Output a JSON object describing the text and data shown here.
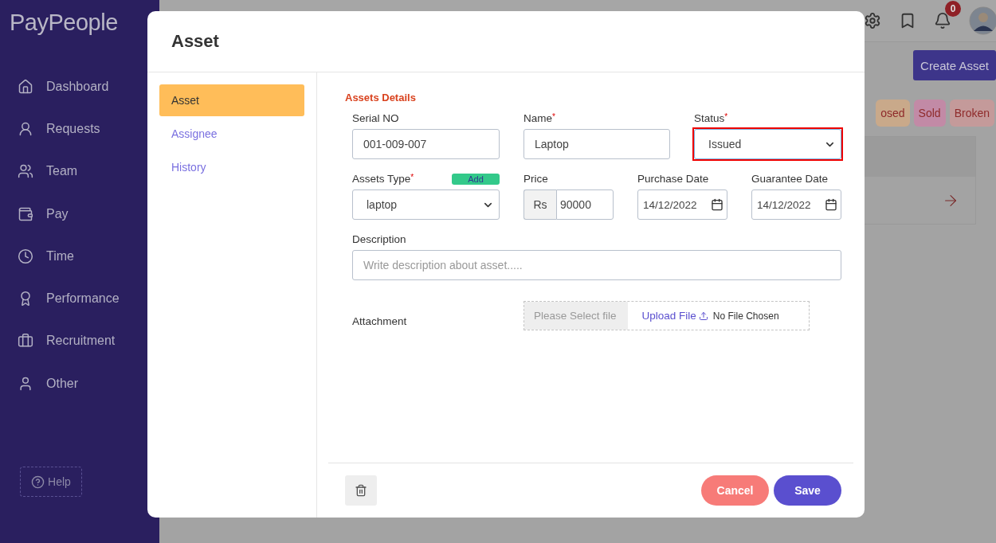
{
  "logo": "PayPeople",
  "sidebar": {
    "items": [
      {
        "label": "Dashboard"
      },
      {
        "label": "Requests"
      },
      {
        "label": "Team"
      },
      {
        "label": "Pay"
      },
      {
        "label": "Time"
      },
      {
        "label": "Performance"
      },
      {
        "label": "Recruitment"
      },
      {
        "label": "Other"
      }
    ],
    "help": "Help"
  },
  "topbar": {
    "notification_count": "0"
  },
  "page": {
    "create_button": "Create Asset",
    "filters": [
      {
        "label": "osed",
        "color": "#c9a98a"
      },
      {
        "label": "Sold",
        "color": "#c28aa6"
      },
      {
        "label": "Broken",
        "color": "#c49a9a"
      }
    ]
  },
  "modal": {
    "title": "Asset",
    "tabs": [
      {
        "label": "Asset",
        "selected": true
      },
      {
        "label": "Assignee",
        "selected": false
      },
      {
        "label": "History",
        "selected": false
      }
    ],
    "section_title": "Assets Details",
    "serial": {
      "label": "Serial NO",
      "value": "001-009-007"
    },
    "name": {
      "label": "Name",
      "value": "Laptop",
      "required_mark": "*"
    },
    "status": {
      "label": "Status",
      "value": "Issued",
      "required_mark": "*",
      "highlighted": true
    },
    "asset_type": {
      "label": "Assets Type",
      "value": "laptop",
      "required_mark": "*",
      "add_button": "Add"
    },
    "price": {
      "label": "Price",
      "currency": "Rs",
      "value": "90000"
    },
    "purchase_date": {
      "label": "Purchase Date",
      "value": "14/12/2022"
    },
    "guarantee_date": {
      "label": "Guarantee Date",
      "value": "14/12/2022"
    },
    "description": {
      "label": "Description",
      "placeholder": "Write description about asset....."
    },
    "attachment": {
      "label": "Attachment",
      "file_placeholder": "Please Select file",
      "upload": "Upload File",
      "status": "No File Chosen"
    },
    "buttons": {
      "cancel": "Cancel",
      "save": "Save"
    }
  }
}
